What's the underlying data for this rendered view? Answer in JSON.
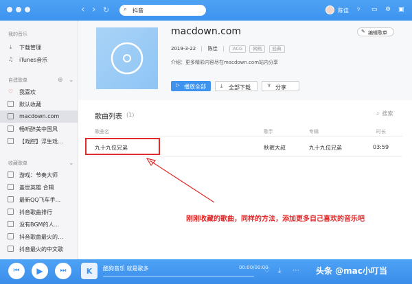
{
  "titlebar": {
    "search_value": "抖音",
    "username": "陈佳"
  },
  "sidebar": {
    "my_music_header": "我的音乐",
    "my_music_items": [
      "下载管理",
      "iTunes音乐"
    ],
    "created_header": "自建歌单",
    "created_items": [
      "我喜欢",
      "默认收藏",
      "macdown.com",
      "畅听醉美中国风",
      "【戏腔】浮生戏..."
    ],
    "collected_header": "收藏歌单",
    "collected_items": [
      "游戏：节奏大师",
      "盖世英雄 合辑",
      "最新QQ飞车手...",
      "抖音歌曲排行",
      "没有BGM的人...",
      "抖音歌曲最火的...",
      "抖音最火的中文歌"
    ]
  },
  "playlist": {
    "title": "macdown.com",
    "date": "2019-3-22",
    "creator": "陈佳",
    "tags": [
      "ACG",
      "网络",
      "经典"
    ],
    "description": "介绍：更多精彩内容尽在macdown.com站内分享",
    "edit_label": "编辑歌单",
    "play_all_label": "播放全部",
    "download_all_label": "全部下载",
    "share_label": "分享"
  },
  "song_list": {
    "title": "歌曲列表",
    "count": "(1)",
    "search_label": "搜索",
    "columns": [
      "歌曲名",
      "歌手",
      "专辑",
      "时长"
    ],
    "rows": [
      {
        "name": "九十九位兄弟",
        "artist": "秋裤大叔",
        "album": "九十九位兄弟",
        "duration": "03:59"
      }
    ]
  },
  "annotation": "刚刚收藏的歌曲，同样的方法，添加更多自己喜欢的音乐吧",
  "player": {
    "track": "酷狗音乐 就是歌多",
    "time": "00:00/00:00"
  },
  "watermark": "头条 @mac小叮当",
  "colors": {
    "accent": "#3d93ee",
    "annotation_red": "#e02b2b"
  }
}
